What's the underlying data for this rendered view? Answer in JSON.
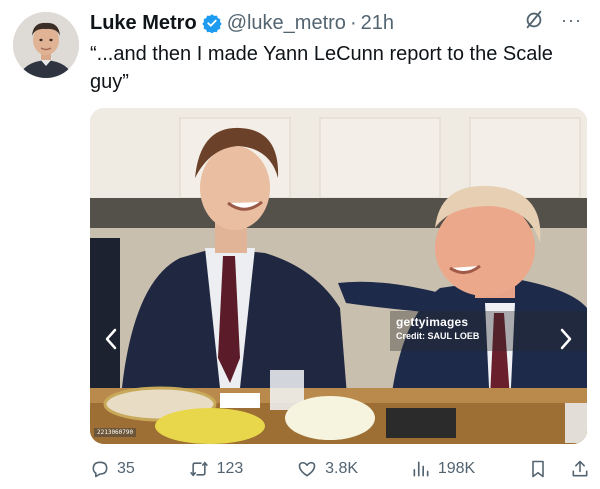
{
  "tweet": {
    "author_name": "Luke Metro",
    "handle": "@luke_metro",
    "separator": "·",
    "time": "21h",
    "more_label": "···",
    "text": "“...and then I made Yann LeCunn report to the Scale guy”"
  },
  "media": {
    "watermark_brand": "gettyimages",
    "watermark_credit": "Credit: SAUL LOEB",
    "photo_id": "2213060790"
  },
  "actions": {
    "replies": "35",
    "reposts": "123",
    "likes": "3.8K",
    "views": "198K"
  },
  "colors": {
    "text": "#0f1419",
    "secondary": "#536471",
    "verified": "#1d9bf0"
  },
  "icons": [
    "verified-badge-icon",
    "grok-icon",
    "more-icon",
    "chevron-left-icon",
    "chevron-right-icon",
    "reply-icon",
    "repost-icon",
    "like-icon",
    "views-icon",
    "bookmark-icon",
    "share-icon"
  ]
}
